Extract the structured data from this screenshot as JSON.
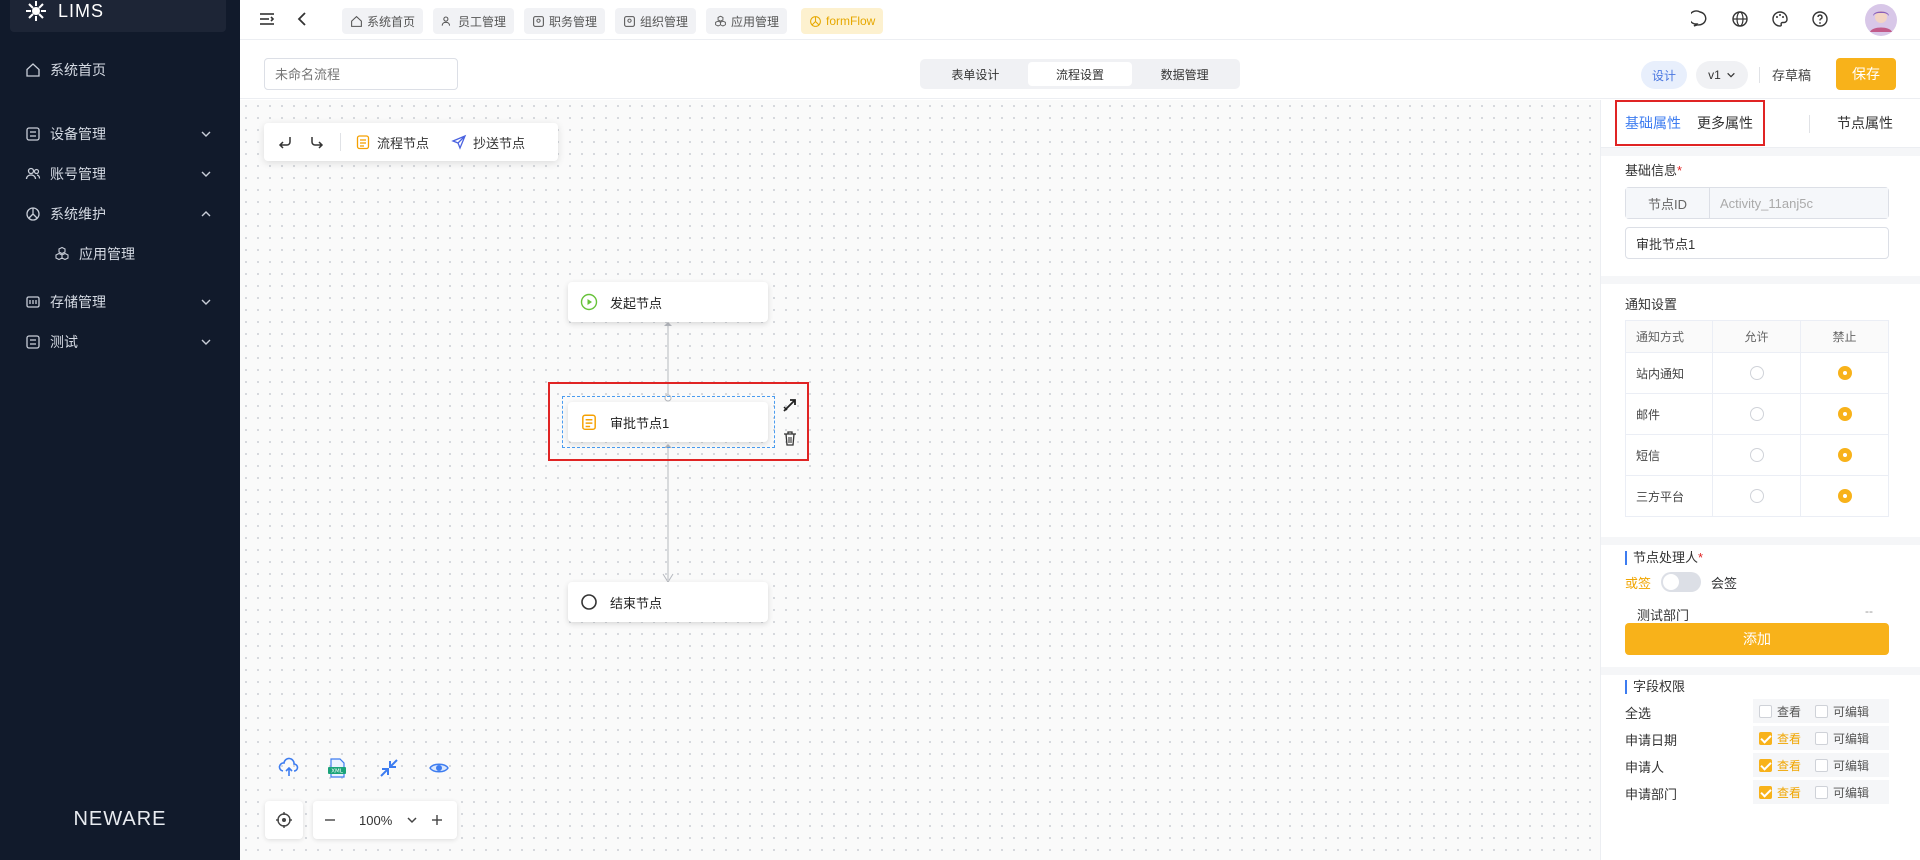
{
  "app": {
    "title": "LIMS",
    "brand": "NEWARE"
  },
  "sidebar": {
    "items": [
      {
        "label": "系统首页",
        "icon": "home-icon"
      },
      {
        "label": "设备管理",
        "icon": "device-icon"
      },
      {
        "label": "账号管理",
        "icon": "users-icon"
      },
      {
        "label": "系统维护",
        "icon": "maintenance-icon",
        "expanded": true
      },
      {
        "label": "应用管理",
        "icon": "app-icon"
      },
      {
        "label": "存储管理",
        "icon": "storage-icon"
      },
      {
        "label": "测试",
        "icon": "test-icon"
      }
    ]
  },
  "topbar": {
    "tabs": [
      {
        "label": "系统首页"
      },
      {
        "label": "员工管理"
      },
      {
        "label": "职务管理"
      },
      {
        "label": "组织管理"
      },
      {
        "label": "应用管理"
      },
      {
        "label": "formFlow",
        "active": true
      }
    ]
  },
  "editor": {
    "flow_name_placeholder": "未命名流程",
    "segments": [
      "表单设计",
      "流程设置",
      "数据管理"
    ],
    "active_segment": "流程设置",
    "design_label": "设计",
    "version": "v1",
    "draft_label": "存草稿",
    "save_label": "保存"
  },
  "canvas": {
    "palette": {
      "flow_node": "流程节点",
      "cc_node": "抄送节点"
    },
    "nodes": {
      "start": "发起节点",
      "approval": "审批节点1",
      "end": "结束节点"
    },
    "zoom": "100%"
  },
  "panel": {
    "tabs": {
      "basic": "基础属性",
      "more": "更多属性",
      "node": "节点属性"
    },
    "basic_info_title": "基础信息",
    "node_id_label": "节点ID",
    "node_id_value": "Activity_11anj5c",
    "node_name": "审批节点1",
    "notify_title": "通知设置",
    "notify_headers": [
      "通知方式",
      "允许",
      "禁止"
    ],
    "notify_rows": [
      {
        "label": "站内通知",
        "allow": false
      },
      {
        "label": "邮件",
        "allow": false
      },
      {
        "label": "短信",
        "allow": false
      },
      {
        "label": "三方平台",
        "allow": false
      }
    ],
    "handler_title": "节点处理人",
    "or_sign": "或签",
    "joint_sign": "会签",
    "dept": "测试部门",
    "dept_remove": "--",
    "add_label": "添加",
    "field_title": "字段权限",
    "view_label": "查看",
    "edit_label": "可编辑",
    "fields": [
      {
        "label": "全选",
        "view": false,
        "edit": false
      },
      {
        "label": "申请日期",
        "view": true,
        "edit": false
      },
      {
        "label": "申请人",
        "view": true,
        "edit": false
      },
      {
        "label": "申请部门",
        "view": true,
        "edit": false
      }
    ]
  },
  "colors": {
    "accent": "#f8b21a",
    "link": "#3d7cf0",
    "sidebar": "#111a2b",
    "highlight": "#e02424"
  }
}
